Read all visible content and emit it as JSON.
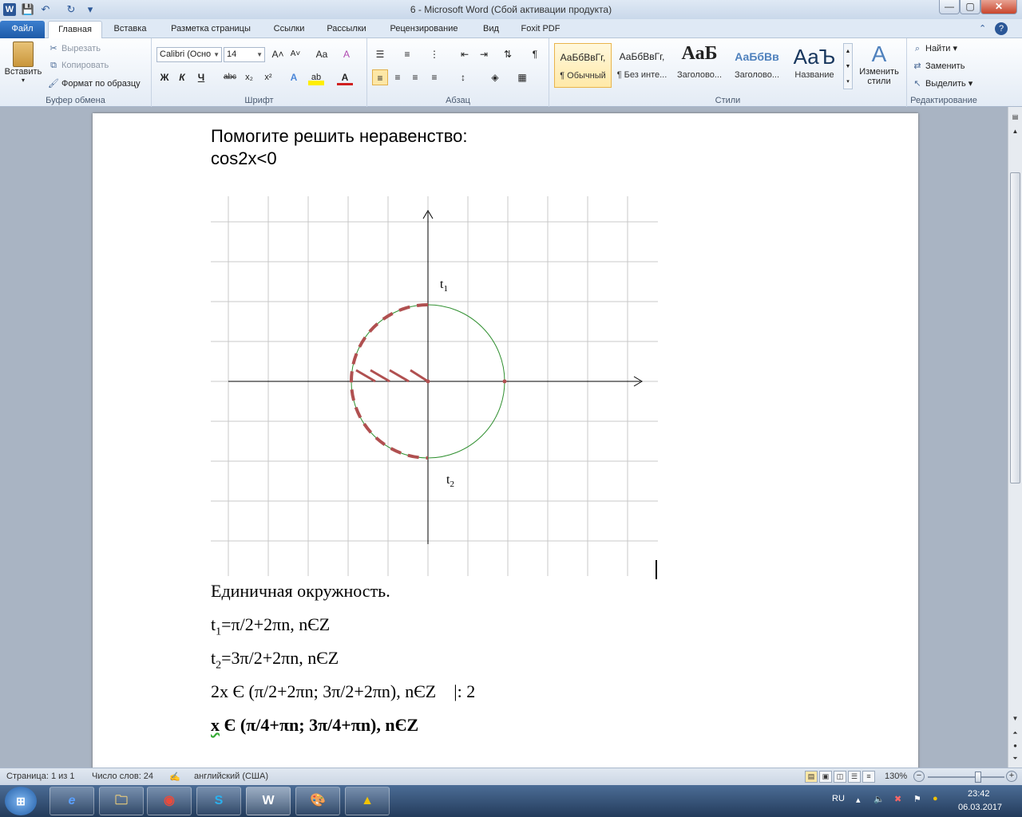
{
  "window": {
    "title": "6  -  Microsoft Word (Сбой активации продукта)",
    "app_icon_letter": "W",
    "minimize": "—",
    "maximize": "▢",
    "close": "✕"
  },
  "qat": {
    "save": "💾",
    "undo": "↶",
    "redo": "↻",
    "customize": "▾"
  },
  "tabs": {
    "file": "Файл",
    "home": "Главная",
    "insert": "Вставка",
    "page_layout": "Разметка страницы",
    "references": "Ссылки",
    "mailings": "Рассылки",
    "review": "Рецензирование",
    "view": "Вид",
    "foxit": "Foxit PDF",
    "minimize_ribbon": "⌃",
    "help": "?"
  },
  "clipboard": {
    "paste": "Вставить",
    "cut": "Вырезать",
    "copy": "Копировать",
    "format_painter": "Формат по образцу",
    "label": "Буфер обмена"
  },
  "font": {
    "name": "Calibri (Осно",
    "size": "14",
    "grow": "A˄",
    "shrink": "A˅",
    "case": "Aa",
    "clear": "A",
    "bold": "Ж",
    "italic": "К",
    "underline": "Ч",
    "strike": "abc",
    "subscript": "x₂",
    "superscript": "x²",
    "effects": "A",
    "highlight": "ab",
    "color": "A",
    "label": "Шрифт"
  },
  "paragraph": {
    "pilcrow": "¶",
    "label": "Абзац"
  },
  "styles": {
    "items": [
      {
        "sample": "АаБбВвГг,",
        "name": "¶ Обычный"
      },
      {
        "sample": "АаБбВвГг,",
        "name": "¶ Без инте..."
      },
      {
        "sample": "АаБ",
        "name": "Заголово..."
      },
      {
        "sample": "АаБбВв",
        "name": "Заголово..."
      },
      {
        "sample": "АаЪ",
        "name": "Название"
      }
    ],
    "change": "Изменить стили",
    "label": "Стили"
  },
  "editing": {
    "find": "Найти",
    "replace": "Заменить",
    "select": "Выделить",
    "label": "Редактирование"
  },
  "document": {
    "title": "Помогите решить неравенство:",
    "equation": "cos2x<0",
    "diagram": {
      "label_t1": "t",
      "sub_1": "1",
      "label_t2": "t",
      "sub_2": "2"
    },
    "unit_circle": "Единичная окружность.",
    "t1_pre": "t",
    "t1_sub": "1",
    "t1_rest": "=π/2+2πn, nЄZ",
    "t2_pre": "t",
    "t2_sub": "2",
    "t2_rest": "=3π/2+2πn, nЄZ",
    "line_2x": "2x Є (π/2+2πn; 3π/2+2πn), nЄZ    |: 2",
    "answer_x": "x",
    "answer_rest": " Є (π/4+πn; 3π/4+πn), nЄZ"
  },
  "status": {
    "page": "Страница: 1 из 1",
    "words": "Число слов: 24",
    "language": "английский (США)",
    "zoom": "130%",
    "zoom_level_percent": 130
  },
  "taskbar": {
    "start": "⊞",
    "apps": [
      "e",
      "🗀",
      "◉",
      "S",
      "W",
      "🎨",
      "▲"
    ],
    "lang": "RU",
    "time": "23:42",
    "date": "06.03.2017"
  },
  "colors": {
    "accent": "#2b5797",
    "file_tab": "#2a6bc0",
    "circle": "#2f8f2f",
    "dash": "#b05050"
  }
}
